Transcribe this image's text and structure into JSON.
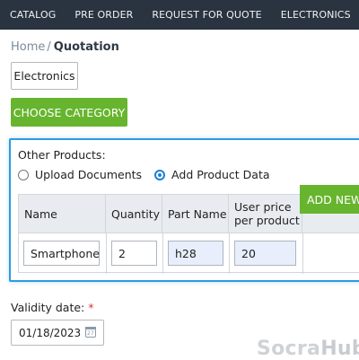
{
  "topnav": {
    "items": [
      "CATALOG",
      "PRE ORDER",
      "REQUEST FOR QUOTE",
      "ELECTRONICS"
    ]
  },
  "breadcrumb": {
    "home": "Home",
    "separator": "/",
    "current": "Quotation"
  },
  "category": {
    "selected": "Electronics",
    "choose_button": "CHOOSE CATEGORY"
  },
  "other_products": {
    "title": "Other Products:",
    "options": [
      "Upload Documents",
      "Add Product Data"
    ],
    "selected_option": "Add Product Data",
    "columns": [
      "Name",
      "Quantity",
      "Part Name",
      "User price per product"
    ],
    "row": {
      "name": "Smartphone",
      "quantity": "2",
      "part_name": "h28",
      "user_price": "20"
    },
    "add_button": "ADD NEW"
  },
  "validity": {
    "label": "Validity date:",
    "required_mark": "*",
    "value": "01/18/2023",
    "calendar_day": "27"
  },
  "watermark": {
    "part1": "Socra",
    "part2": "Hub"
  },
  "colors": {
    "nav_bg": "#2a3340",
    "accent_green": "#67b52e",
    "panel_border": "#2f9be0"
  }
}
